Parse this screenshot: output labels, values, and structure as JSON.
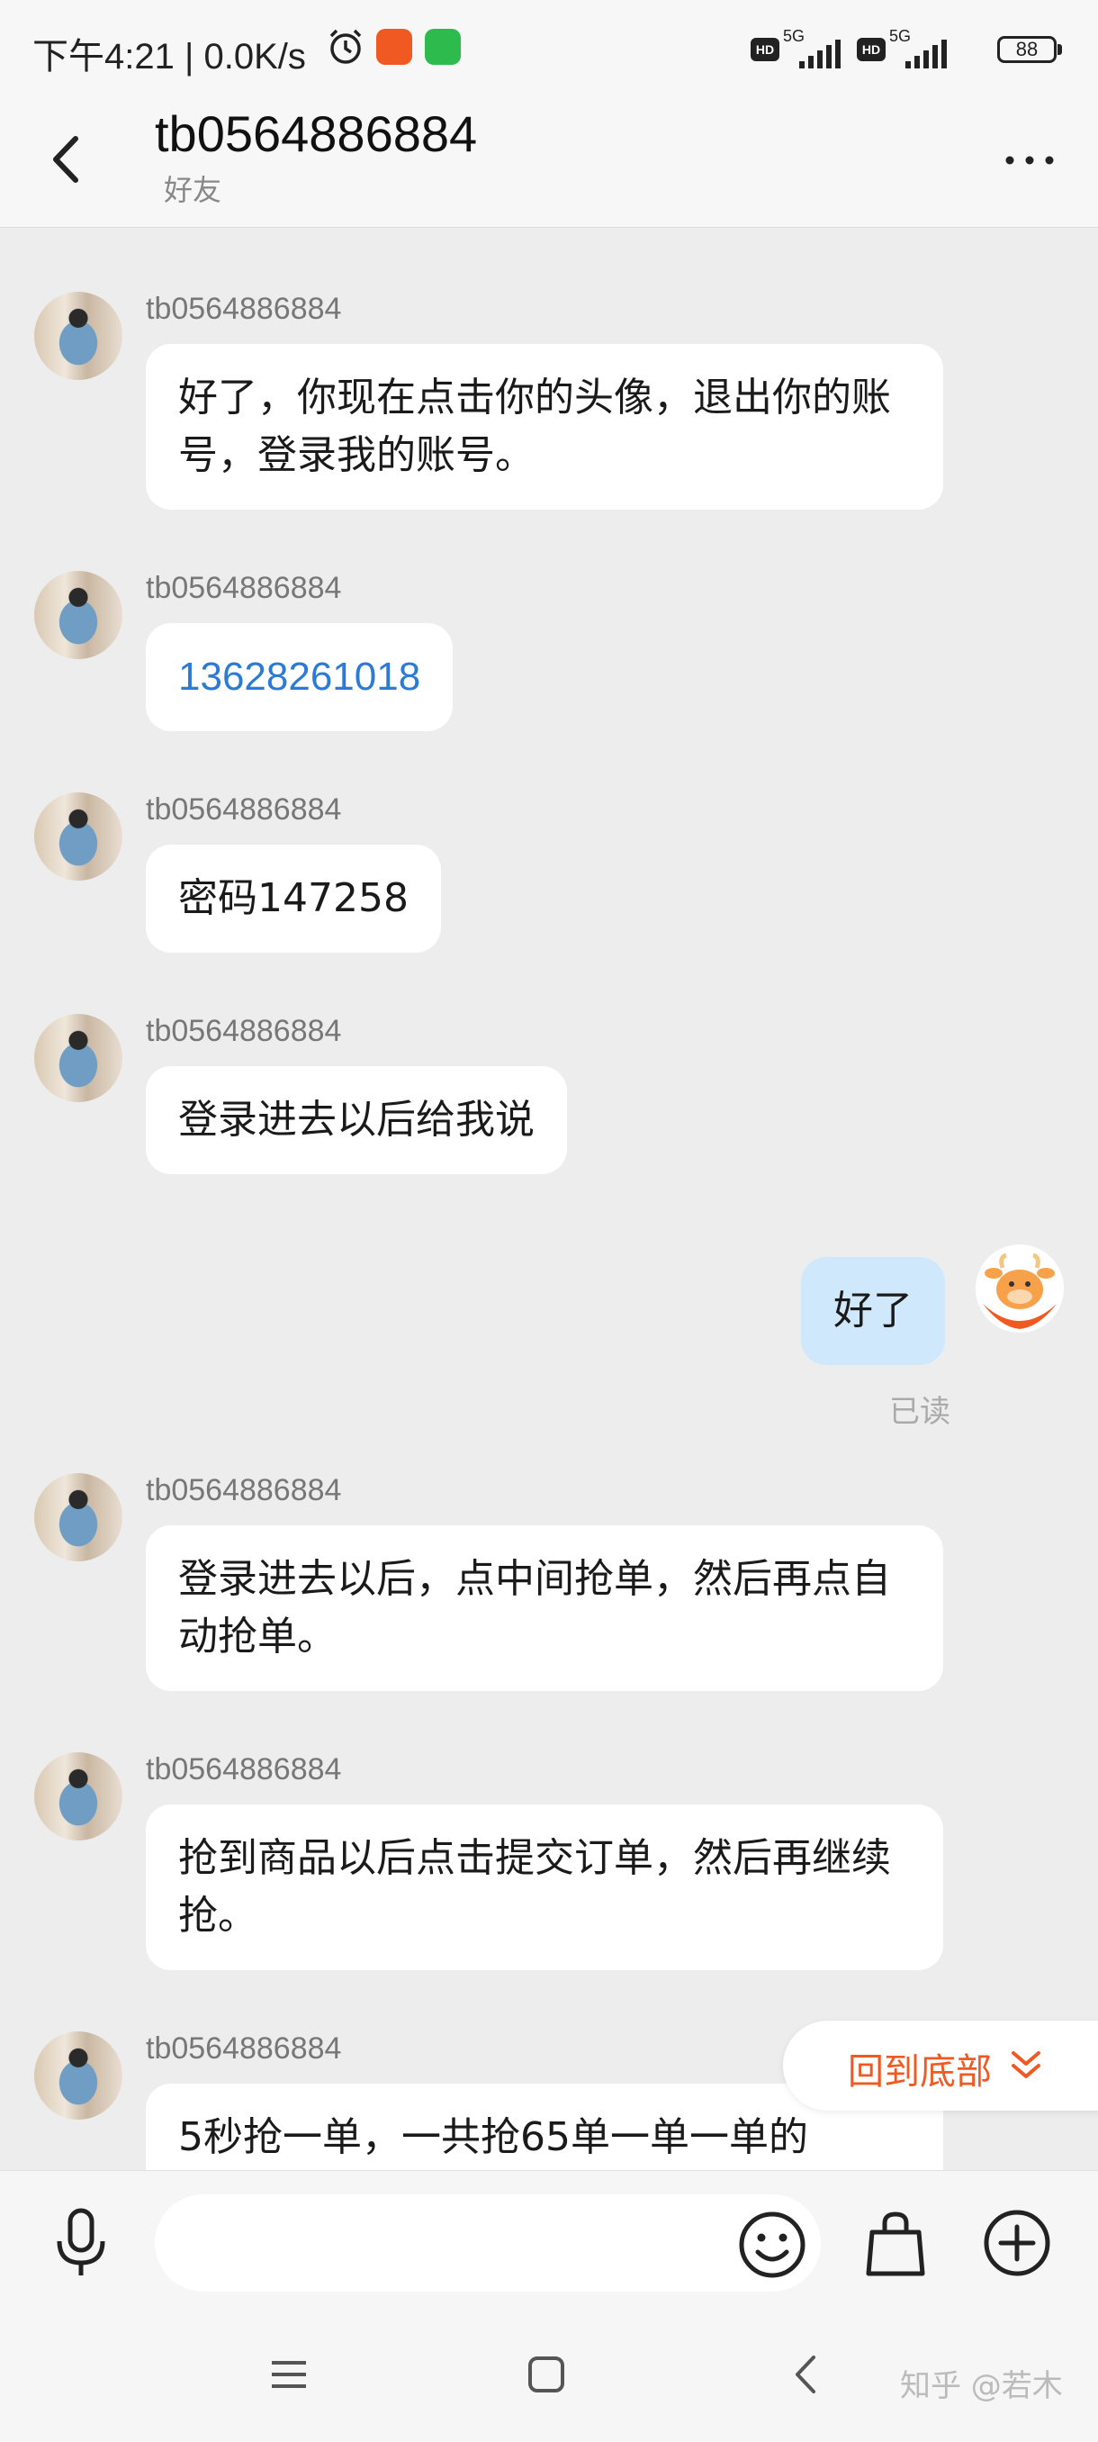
{
  "status_bar": {
    "time": "下午4:21 | 0.0K/s",
    "network": "5G",
    "hd": "HD",
    "battery": "88"
  },
  "header": {
    "title": "tb0564886884",
    "subtitle": "好友"
  },
  "messages": [
    {
      "sender": "tb0564886884",
      "text": "好了，你现在点击你的头像，退出你的账号，登录我的账号。"
    },
    {
      "sender": "tb0564886884",
      "text": "13628261018"
    },
    {
      "sender": "tb0564886884",
      "text": "密码147258"
    },
    {
      "sender": "tb0564886884",
      "text": "登录进去以后给我说"
    },
    {
      "sender": "me",
      "text": "好了",
      "status": "已读"
    },
    {
      "sender": "tb0564886884",
      "text": "登录进去以后，点中间抢单，然后再点自动抢单。"
    },
    {
      "sender": "tb0564886884",
      "text": "抢到商品以后点击提交订单，然后再继续抢。"
    },
    {
      "sender": "tb0564886884",
      "text": "5秒抢一单，一共抢65单一单一单的"
    }
  ],
  "scroll_to_bottom": {
    "label": "回到底部"
  },
  "input": {
    "placeholder": ""
  },
  "watermark": "知乎 @若木",
  "colors": {
    "accent": "#f05a22",
    "link": "#2b7bd6",
    "my_bubble": "#cfe8fb",
    "chat_bg": "#ededed"
  },
  "icons": [
    "back-arrow-icon",
    "more-dots-icon",
    "alarm-icon",
    "mic-icon",
    "emoji-icon",
    "shopping-bag-icon",
    "plus-circle-icon",
    "chevron-down-icon",
    "menu-icon",
    "home-square-icon",
    "nav-back-icon"
  ]
}
